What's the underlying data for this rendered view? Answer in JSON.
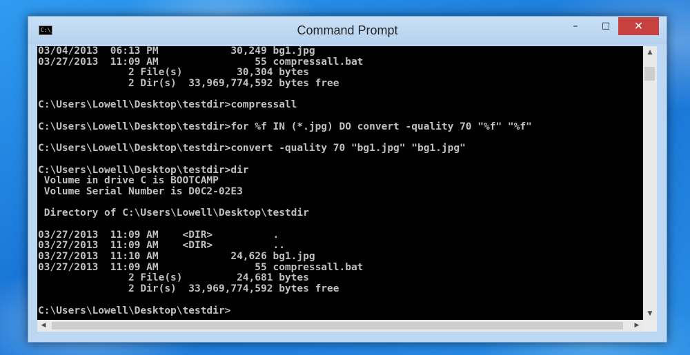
{
  "window": {
    "title": "Command Prompt",
    "icon": "console-icon",
    "icon_text": "C:\\_",
    "controls": {
      "minimize": "–",
      "maximize": "□",
      "close": "✕"
    }
  },
  "console": {
    "lines": [
      "03/04/2013  06:13 PM            30,249 bg1.jpg",
      "03/27/2013  11:09 AM                55 compressall.bat",
      "               2 File(s)         30,304 bytes",
      "               2 Dir(s)  33,969,774,592 bytes free",
      "",
      "C:\\Users\\Lowell\\Desktop\\testdir>compressall",
      "",
      "C:\\Users\\Lowell\\Desktop\\testdir>for %f IN (*.jpg) DO convert -quality 70 \"%f\" \"%f\"",
      "",
      "C:\\Users\\Lowell\\Desktop\\testdir>convert -quality 70 \"bg1.jpg\" \"bg1.jpg\"",
      "",
      "C:\\Users\\Lowell\\Desktop\\testdir>dir",
      " Volume in drive C is BOOTCAMP",
      " Volume Serial Number is D0C2-02E3",
      "",
      " Directory of C:\\Users\\Lowell\\Desktop\\testdir",
      "",
      "03/27/2013  11:09 AM    <DIR>          .",
      "03/27/2013  11:09 AM    <DIR>          ..",
      "03/27/2013  11:10 AM            24,626 bg1.jpg",
      "03/27/2013  11:09 AM                55 compressall.bat",
      "               2 File(s)         24,681 bytes",
      "               2 Dir(s)  33,969,774,592 bytes free",
      "",
      "C:\\Users\\Lowell\\Desktop\\testdir>"
    ]
  },
  "scrollbars": {
    "up": "▲",
    "down": "▼",
    "left": "◀",
    "right": "▶"
  },
  "colors": {
    "console_background": "#000000",
    "console_text": "#c0c0c0",
    "close_button": "#c7413e",
    "window_frame": "#bcd7f2"
  }
}
